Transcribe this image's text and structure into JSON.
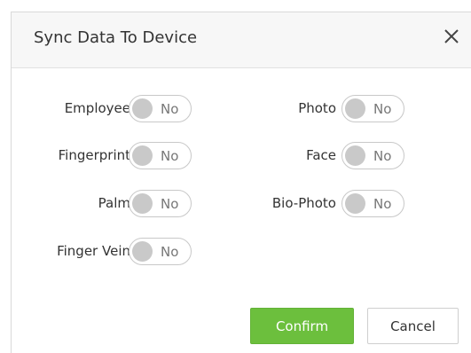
{
  "dialog": {
    "title": "Sync Data To Device",
    "close_icon": "close-icon"
  },
  "fields": {
    "employee": {
      "label": "Employee",
      "state": "No"
    },
    "photo": {
      "label": "Photo",
      "state": "No"
    },
    "fingerprint": {
      "label": "Fingerprint",
      "state": "No"
    },
    "face": {
      "label": "Face",
      "state": "No"
    },
    "palm": {
      "label": "Palm",
      "state": "No"
    },
    "bio_photo": {
      "label": "Bio-Photo",
      "state": "No"
    },
    "finger_vein": {
      "label": "Finger Vein",
      "state": "No"
    }
  },
  "buttons": {
    "confirm": "Confirm",
    "cancel": "Cancel"
  },
  "colors": {
    "confirm_bg": "#6cbf3d",
    "toggle_knob": "#c9c9c9",
    "header_bg": "#f7f7f7"
  }
}
